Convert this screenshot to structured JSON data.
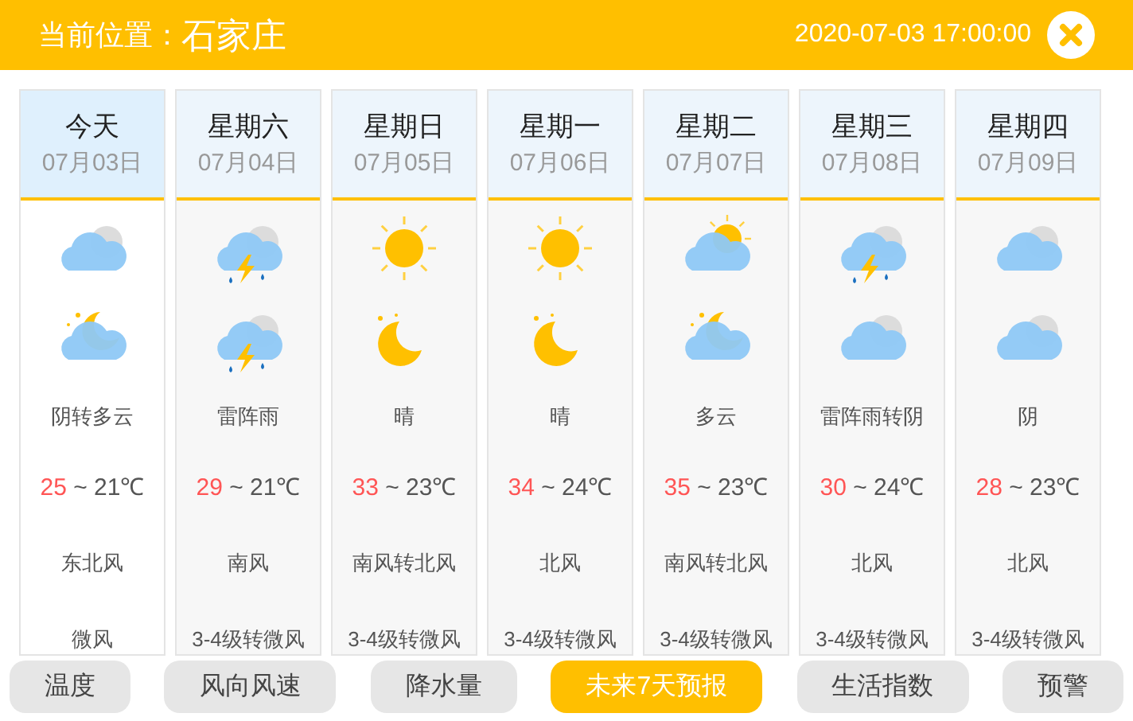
{
  "header": {
    "location_label": "当前位置：",
    "city": "石家庄",
    "datetime": "2020-07-03 17:00:00"
  },
  "days": [
    {
      "weekday": "今天",
      "date": "07月03日",
      "selected": true,
      "icons": [
        {
          "kind": "cloudy"
        },
        {
          "kind": "cloudy-night"
        }
      ],
      "weather": "阴转多云",
      "high": "25",
      "low": "~ 21℃",
      "wind_dir": "东北风",
      "wind_level": "微风"
    },
    {
      "weekday": "星期六",
      "date": "07月04日",
      "selected": false,
      "icons": [
        {
          "kind": "thunder"
        },
        {
          "kind": "thunder"
        }
      ],
      "weather": "雷阵雨",
      "high": "29",
      "low": "~ 21℃",
      "wind_dir": "南风",
      "wind_level": "3-4级转微风"
    },
    {
      "weekday": "星期日",
      "date": "07月05日",
      "selected": false,
      "icons": [
        {
          "kind": "sunny"
        },
        {
          "kind": "moon"
        }
      ],
      "weather": "晴",
      "high": "33",
      "low": "~ 23℃",
      "wind_dir": "南风转北风",
      "wind_level": "3-4级转微风"
    },
    {
      "weekday": "星期一",
      "date": "07月06日",
      "selected": false,
      "icons": [
        {
          "kind": "sunny"
        },
        {
          "kind": "moon"
        }
      ],
      "weather": "晴",
      "high": "34",
      "low": "~ 24℃",
      "wind_dir": "北风",
      "wind_level": "3-4级转微风"
    },
    {
      "weekday": "星期二",
      "date": "07月07日",
      "selected": false,
      "icons": [
        {
          "kind": "cloudy-day"
        },
        {
          "kind": "cloudy-night"
        }
      ],
      "weather": "多云",
      "high": "35",
      "low": "~ 23℃",
      "wind_dir": "南风转北风",
      "wind_level": "3-4级转微风"
    },
    {
      "weekday": "星期三",
      "date": "07月08日",
      "selected": false,
      "icons": [
        {
          "kind": "thunder"
        },
        {
          "kind": "cloudy"
        }
      ],
      "weather": "雷阵雨转阴",
      "high": "30",
      "low": "~ 24℃",
      "wind_dir": "北风",
      "wind_level": "3-4级转微风"
    },
    {
      "weekday": "星期四",
      "date": "07月09日",
      "selected": false,
      "icons": [
        {
          "kind": "cloudy"
        },
        {
          "kind": "cloudy"
        }
      ],
      "weather": "阴",
      "high": "28",
      "low": "~ 23℃",
      "wind_dir": "北风",
      "wind_level": "3-4级转微风"
    }
  ],
  "tabs": [
    {
      "label": "温度",
      "selected": false
    },
    {
      "label": "风向风速",
      "selected": false
    },
    {
      "label": "降水量",
      "selected": false
    },
    {
      "label": "未来7天预报",
      "selected": true
    },
    {
      "label": "生活指数",
      "selected": false
    },
    {
      "label": "预警",
      "selected": false
    }
  ]
}
